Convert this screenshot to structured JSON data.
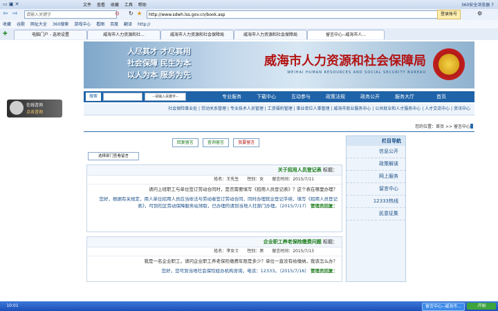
{
  "browser": {
    "title": "360安全浏览器 7",
    "menu": [
      "文件",
      "查看",
      "收藏",
      "工具",
      "帮助"
    ],
    "address": "http://www.sdwh.lss.gov.cn/book.asp",
    "search_placeholder": "点此搜索",
    "login_label": "登录账号",
    "favorites": [
      "收藏",
      "谷歌",
      "网址大全",
      "360搜索",
      "游戏中心",
      "看图",
      "百度",
      "翻译",
      "http://"
    ],
    "tabs": [
      "留言中心--威海市人...",
      "威海市人力资源和社会保障局",
      "威海市人力资源和社会保障局",
      "威海市人力资源和社...",
      "电脑门户 - 选项设置"
    ],
    "tabs_active_index": 0
  },
  "page": {
    "site_title": "威海市人力资源和社会保障局",
    "site_subtitle_en": "WEIHAI HUMAN RESOURCES AND SOCIAL SECURITY BUREAU",
    "banner_slogan": [
      "人尽其才 才尽其用",
      "社会保障 民生为本",
      "以人为本 服务为先"
    ],
    "nav_items": [
      "首页",
      "服务大厅",
      "政务公开",
      "政策法规",
      "互动参与",
      "下载中心",
      "专业服务"
    ],
    "nav_search": {
      "select_value": "--请输入关键字--",
      "input_placeholder": "请输入关键字",
      "button": "搜索"
    },
    "links": [
      "资讯中心",
      "人才交流中心",
      "公共就业和人才服务中心",
      "威海市就业服务中心",
      "事业单位人事管理",
      "工资福利管理",
      "专业技术人员管理",
      "劳动关系管理",
      "社会保险事业处"
    ],
    "breadcrumb": "您的位置：首页 >> 留言中心",
    "side_title": "栏目导航",
    "side_items": [
      "信息公开",
      "政策解读",
      "网上服务",
      "留言中心",
      "12333热线",
      "民意征集"
    ],
    "tools": {
      "write": "我要留言",
      "search": "查询留言",
      "reply": "回复留言"
    },
    "dept_select": "选择部门查看留言"
  },
  "messages": [
    {
      "label": "标题：",
      "title": "关于招用人员登记表",
      "meta": "姓名：王先生　　性别：女　　留言时间：2015/7/11",
      "question": "请问上班职工与单位签订劳动合同时，是否需要填写《招用人员登记表》？这个表在哪里办理？",
      "reply_label": "管理员回复：",
      "reply": "您好，根据有关规定，用人单位招用人员应当依法与劳动者签订劳动合同，同时办理就业登记手续，填写《招用人员登记表》，可到社区劳动保障服务站领取，已办理的请到当地人社部门办理。（2015/7/17）"
    },
    {
      "label": "标题：",
      "title": "企业职工养老保险缴费问题",
      "meta": "姓名：李女士　　性别：男　　留言时间：2015/7/13",
      "question": "我是一名企业职工，请问企业职工养老保险缴费年限是多少？单位一直没有给缴纳，我该怎么办？",
      "reply_label": "管理员回复：",
      "reply": "您好，您可到当地社会保险经办机构咨询，电话：12333。（2015/7/16）"
    }
  ],
  "float_banner": {
    "line1": "在线咨询",
    "line2": "点击咨询"
  },
  "taskbar": {
    "start": "开始",
    "window": "留言中心--威海市...",
    "clock": "10:01"
  }
}
